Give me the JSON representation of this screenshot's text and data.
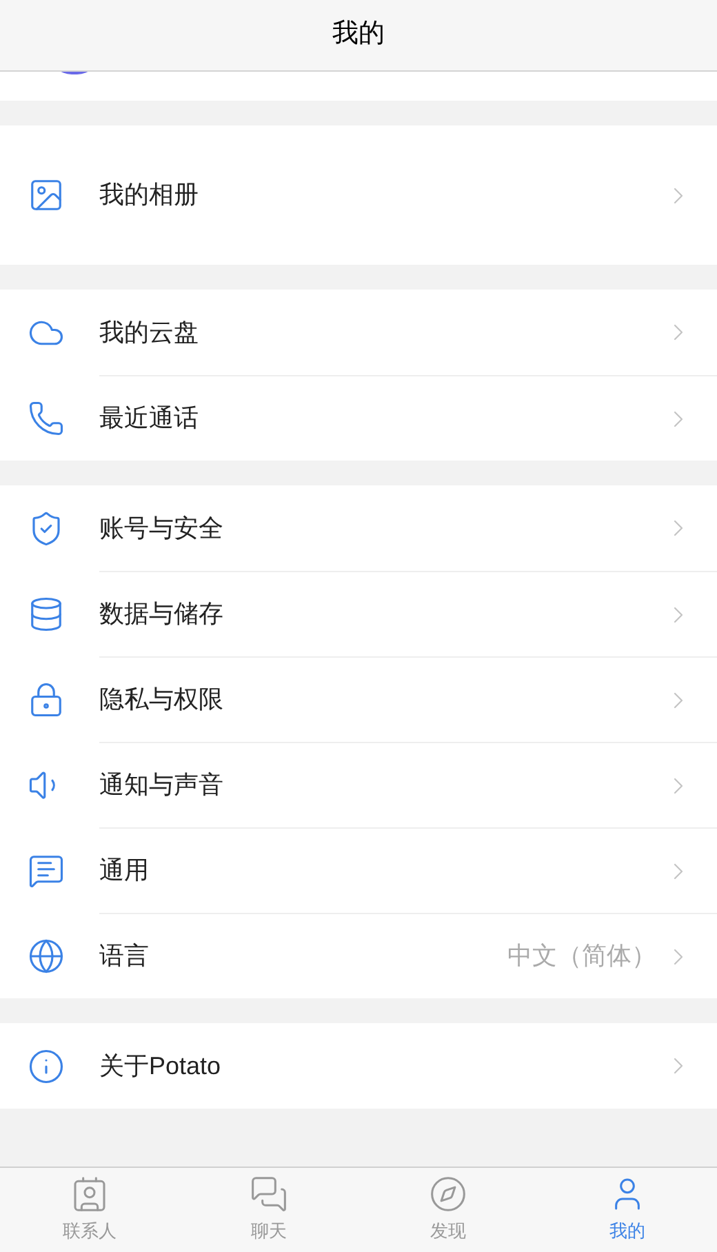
{
  "header": {
    "title": "我的"
  },
  "groups": [
    {
      "items": [
        {
          "kind": "album",
          "label": "我的相册"
        }
      ]
    },
    {
      "items": [
        {
          "kind": "cloud",
          "label": "我的云盘"
        },
        {
          "kind": "phone",
          "label": "最近通话"
        }
      ]
    },
    {
      "items": [
        {
          "kind": "shield",
          "label": "账号与安全"
        },
        {
          "kind": "database",
          "label": "数据与储存"
        },
        {
          "kind": "lock",
          "label": "隐私与权限"
        },
        {
          "kind": "sound",
          "label": "通知与声音"
        },
        {
          "kind": "general",
          "label": "通用"
        },
        {
          "kind": "globe",
          "label": "语言",
          "value": "中文（简体）"
        }
      ]
    },
    {
      "items": [
        {
          "kind": "info",
          "label": "关于Potato"
        }
      ]
    }
  ],
  "tabs": [
    {
      "kind": "contacts",
      "label": "联系人",
      "selected": false
    },
    {
      "kind": "chat",
      "label": "聊天",
      "selected": false
    },
    {
      "kind": "discover",
      "label": "发现",
      "selected": false
    },
    {
      "kind": "me",
      "label": "我的",
      "selected": true
    }
  ]
}
